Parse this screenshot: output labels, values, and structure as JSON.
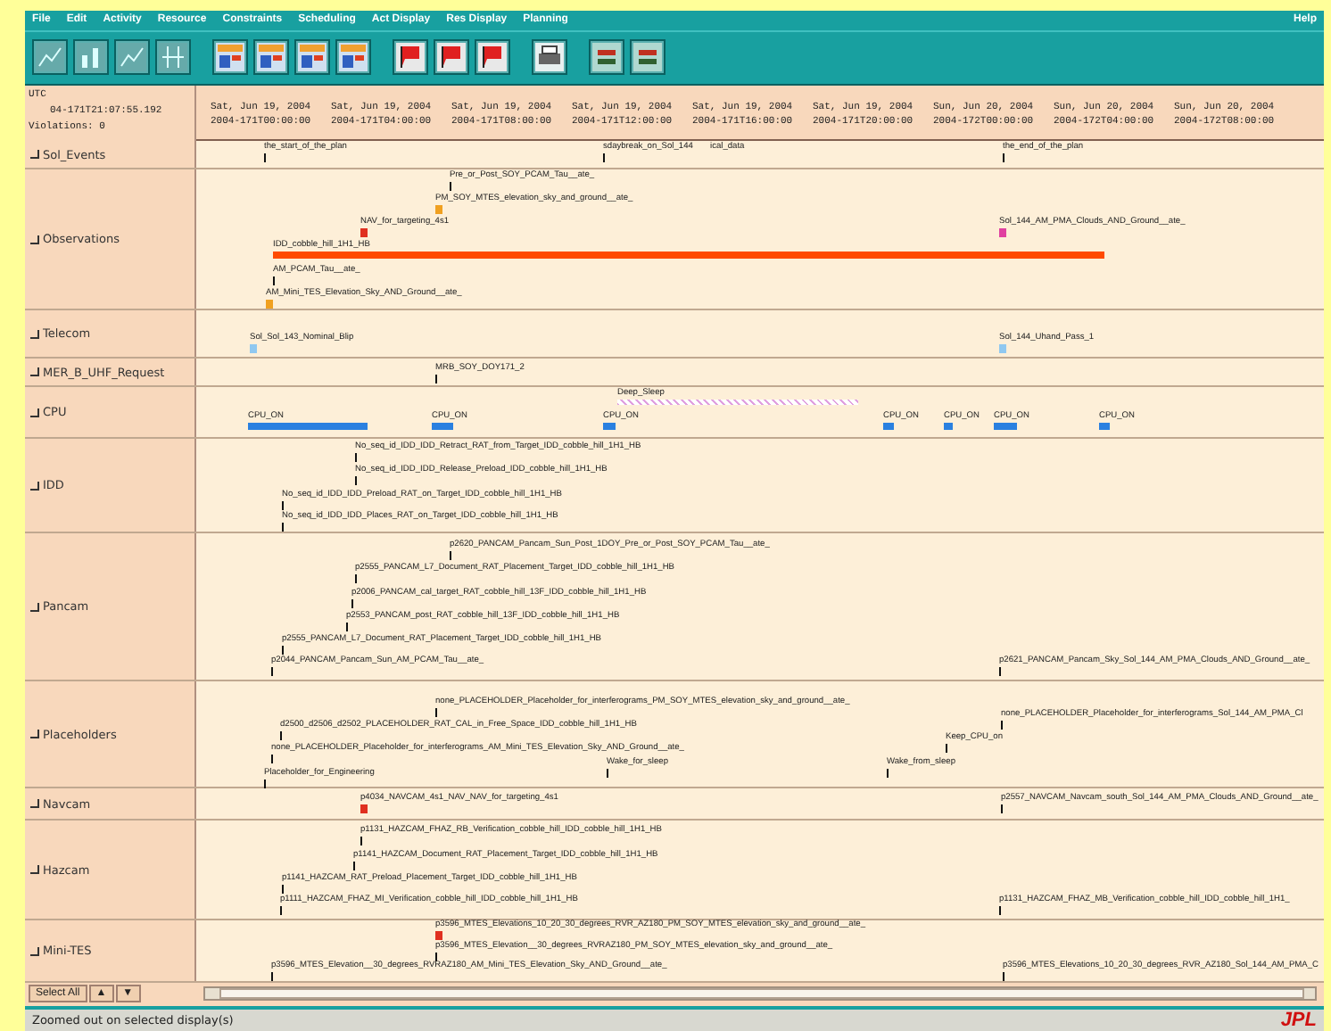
{
  "menu": [
    "File",
    "Edit",
    "Activity",
    "Resource",
    "Constraints",
    "Scheduling",
    "Act Display",
    "Res Display",
    "Planning",
    "Help"
  ],
  "header": {
    "zone": "UTC",
    "clock": "04-171T21:07:55.192",
    "violations": "Violations: 0",
    "times": [
      {
        "day": "Sat, Jun 19, 2004",
        "stamp": "2004-171T00:00:00"
      },
      {
        "day": "Sat, Jun 19, 2004",
        "stamp": "2004-171T04:00:00"
      },
      {
        "day": "Sat, Jun 19, 2004",
        "stamp": "2004-171T08:00:00"
      },
      {
        "day": "Sat, Jun 19, 2004",
        "stamp": "2004-171T12:00:00"
      },
      {
        "day": "Sat, Jun 19, 2004",
        "stamp": "2004-171T16:00:00"
      },
      {
        "day": "Sat, Jun 19, 2004",
        "stamp": "2004-171T20:00:00"
      },
      {
        "day": "Sun, Jun 20, 2004",
        "stamp": "2004-172T00:00:00"
      },
      {
        "day": "Sun, Jun 20, 2004",
        "stamp": "2004-172T04:00:00"
      },
      {
        "day": "Sun, Jun 20, 2004",
        "stamp": "2004-172T08:00:00"
      }
    ]
  },
  "rows": [
    {
      "label": "Sol_Events",
      "events": [
        {
          "label": "the_start_of_the_plan",
          "kind": "tick"
        },
        {
          "label": "sdaybreak_on_Sol_144",
          "kind": "tick"
        },
        {
          "label": "ical_data",
          "kind": "text"
        },
        {
          "label": "the_end_of_the_plan",
          "kind": "tick"
        }
      ]
    },
    {
      "label": "Observations",
      "events": [
        {
          "label": "Pre_or_Post_SOY_PCAM_Tau__ate_",
          "kind": "tick"
        },
        {
          "label": "PM_SOY_MTES_elevation_sky_and_ground__ate_",
          "kind": "marker",
          "color": "#f0a020"
        },
        {
          "label": "NAV_for_targeting_4s1",
          "kind": "marker",
          "color": "#e03020"
        },
        {
          "label": "IDD_cobble_hill_1H1_HB",
          "kind": "bar",
          "color": "#ff4a00"
        },
        {
          "label": "AM_PCAM_Tau__ate_",
          "kind": "tick"
        },
        {
          "label": "AM_Mini_TES_Elevation_Sky_AND_Ground__ate_",
          "kind": "marker",
          "color": "#f0a020"
        },
        {
          "label": "Sol_144_AM_PMA_Clouds_AND_Ground__ate_",
          "kind": "marker",
          "color": "#e040a0"
        }
      ]
    },
    {
      "label": "Telecom",
      "events": [
        {
          "label": "Sol_Sol_143_Nominal_Blip",
          "kind": "marker",
          "color": "#90c8f0"
        },
        {
          "label": "Sol_144_Uhand_Pass_1",
          "kind": "marker",
          "color": "#90c8f0"
        }
      ]
    },
    {
      "label": "MER_B_UHF_Request",
      "events": [
        {
          "label": "MRB_SOY_DOY171_2",
          "kind": "tick"
        }
      ]
    },
    {
      "label": "CPU",
      "events": [
        {
          "label": "Deep_Sleep",
          "kind": "hatch",
          "color": "#e0a0e0"
        },
        {
          "label": "CPU_ON",
          "kind": "bar",
          "color": "#2a80e0"
        },
        {
          "label": "CPU_ON",
          "kind": "bar",
          "color": "#2a80e0"
        },
        {
          "label": "CPU_ON",
          "kind": "bar",
          "color": "#2a80e0"
        },
        {
          "label": "CPU_ON",
          "kind": "bar",
          "color": "#2a80e0"
        },
        {
          "label": "CPU_ON",
          "kind": "bar",
          "color": "#2a80e0"
        },
        {
          "label": "CPU_ON",
          "kind": "bar",
          "color": "#2a80e0"
        },
        {
          "label": "CPU_ON",
          "kind": "bar",
          "color": "#2a80e0"
        }
      ]
    },
    {
      "label": "IDD",
      "events": [
        {
          "label": "No_seq_id_IDD_IDD_Retract_RAT_from_Target_IDD_cobble_hill_1H1_HB",
          "kind": "tick"
        },
        {
          "label": "No_seq_id_IDD_IDD_Release_Preload_IDD_cobble_hill_1H1_HB",
          "kind": "tick"
        },
        {
          "label": "No_seq_id_IDD_IDD_Preload_RAT_on_Target_IDD_cobble_hill_1H1_HB",
          "kind": "tick"
        },
        {
          "label": "No_seq_id_IDD_IDD_Places_RAT_on_Target_IDD_cobble_hill_1H1_HB",
          "kind": "tick"
        }
      ]
    },
    {
      "label": "Pancam",
      "events": [
        {
          "label": "p2620_PANCAM_Pancam_Sun_Post_1DOY_Pre_or_Post_SOY_PCAM_Tau__ate_",
          "kind": "tick"
        },
        {
          "label": "p2555_PANCAM_L7_Document_RAT_Placement_Target_IDD_cobble_hill_1H1_HB",
          "kind": "tick"
        },
        {
          "label": "p2006_PANCAM_cal_target_RAT_cobble_hill_13F_IDD_cobble_hill_1H1_HB",
          "kind": "tick"
        },
        {
          "label": "p2553_PANCAM_post_RAT_cobble_hill_13F_IDD_cobble_hill_1H1_HB",
          "kind": "tick"
        },
        {
          "label": "p2555_PANCAM_L7_Document_RAT_Placement_Target_IDD_cobble_hill_1H1_HB",
          "kind": "tick"
        },
        {
          "label": "p2044_PANCAM_Pancam_Sun_AM_PCAM_Tau__ate_",
          "kind": "tick"
        },
        {
          "label": "p2621_PANCAM_Pancam_Sky_Sol_144_AM_PMA_Clouds_AND_Ground__ate_",
          "kind": "tick"
        }
      ]
    },
    {
      "label": "Placeholders",
      "events": [
        {
          "label": "none_PLACEHOLDER_Placeholder_for_interferograms_PM_SOY_MTES_elevation_sky_and_ground__ate_",
          "kind": "tick"
        },
        {
          "label": "none_PLACEHOLDER_Placeholder_for_interferograms_Sol_144_AM_PMA_Cl",
          "kind": "tick"
        },
        {
          "label": "d2500_d2506_d2502_PLACEHOLDER_RAT_CAL_in_Free_Space_IDD_cobble_hill_1H1_HB",
          "kind": "tick"
        },
        {
          "label": "Keep_CPU_on",
          "kind": "tick"
        },
        {
          "label": "none_PLACEHOLDER_Placeholder_for_interferograms_AM_Mini_TES_Elevation_Sky_AND_Ground__ate_",
          "kind": "tick"
        },
        {
          "label": "Wake_for_sleep",
          "kind": "tick"
        },
        {
          "label": "Wake_from_sleep",
          "kind": "tick"
        },
        {
          "label": "Placeholder_for_Engineering",
          "kind": "tick"
        }
      ]
    },
    {
      "label": "Navcam",
      "events": [
        {
          "label": "p4034_NAVCAM_4s1_NAV_NAV_for_targeting_4s1",
          "kind": "marker",
          "color": "#e03020"
        },
        {
          "label": "p2557_NAVCAM_Navcam_south_Sol_144_AM_PMA_Clouds_AND_Ground__ate_",
          "kind": "tick"
        }
      ]
    },
    {
      "label": "Hazcam",
      "events": [
        {
          "label": "p1131_HAZCAM_FHAZ_RB_Verification_cobble_hill_IDD_cobble_hill_1H1_HB",
          "kind": "tick"
        },
        {
          "label": "p1141_HAZCAM_Document_RAT_Placement_Target_IDD_cobble_hill_1H1_HB",
          "kind": "tick"
        },
        {
          "label": "p1141_HAZCAM_RAT_Preload_Placement_Target_IDD_cobble_hill_1H1_HB",
          "kind": "tick"
        },
        {
          "label": "p1111_HAZCAM_FHAZ_MI_Verification_cobble_hill_IDD_cobble_hill_1H1_HB",
          "kind": "tick"
        },
        {
          "label": "p1131_HAZCAM_FHAZ_MB_Verification_cobble_hill_IDD_cobble_hill_1H1_",
          "kind": "tick"
        }
      ]
    },
    {
      "label": "Mini-TES",
      "events": [
        {
          "label": "p3596_MTES_Elevations_10_20_30_degrees_RVR_AZ180_PM_SOY_MTES_elevation_sky_and_ground__ate_",
          "kind": "marker",
          "color": "#e03020"
        },
        {
          "label": "p3596_MTES_Elevation__30_degrees_RVRAZ180_PM_SOY_MTES_elevation_sky_and_ground__ate_",
          "kind": "tick"
        },
        {
          "label": "p3596_MTES_Elevation__30_degrees_RVRAZ180_AM_Mini_TES_Elevation_Sky_AND_Ground__ate_",
          "kind": "tick"
        },
        {
          "label": "p3596_MTES_Elevations_10_20_30_degrees_RVR_AZ180_Sol_144_AM_PMA_C",
          "kind": "tick"
        }
      ]
    }
  ],
  "footer": {
    "select_all": "Select All",
    "up": "▲",
    "down": "▼"
  },
  "status": "Zoomed out on selected display(s)",
  "logo": "JPL"
}
